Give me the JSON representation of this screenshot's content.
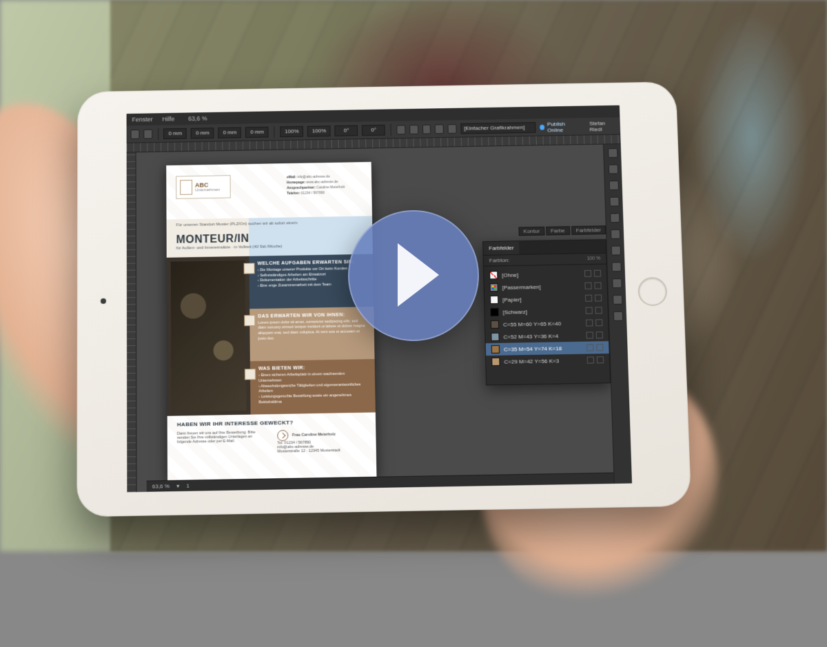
{
  "menu": {
    "items": [
      "Fenster",
      "Hilfe"
    ],
    "zoom": "63,6 %"
  },
  "control_bar": {
    "fields": [
      "0 mm",
      "0 mm",
      "0 mm",
      "0 mm",
      "100%",
      "100%",
      "0°",
      "0°"
    ],
    "publish": "Publish Online",
    "user": "Stefan Riedl"
  },
  "page": {
    "logo": {
      "name": "ABC",
      "sub": "Unternehmen"
    },
    "meta": [
      {
        "label": "eMail:",
        "value": "info@abc-adresse.de"
      },
      {
        "label": "Homepage:",
        "value": "www.abc-adresse.de"
      },
      {
        "label": "Ansprechpartner:",
        "value": "Caroline Meierholz"
      },
      {
        "label": "Telefon:",
        "value": "01234 / 567890"
      }
    ],
    "lead": "Für unseren Standort Muster (PLZ/Ort) suchen wir ab sofort eine/n",
    "title": "MONTEUR/IN",
    "subtitle": "für Außen- und Inneneinsätze · in Vollzeit (40 Std./Woche)",
    "blocks": {
      "a": {
        "heading": "WELCHE AUFGABEN ERWARTEN SIE:",
        "items": [
          "Die Montage unserer Produkte vor Ort beim Kunden",
          "Selbstständiges Arbeiten am Einsatzort",
          "Dokumentation der Arbeitsschritte",
          "Eine enge Zusammenarbeit mit dem Team"
        ]
      },
      "b": {
        "heading": "DAS ERWARTEN WIR VON IHNEN:",
        "text": "Lorem ipsum dolor sit amet, consetetur sadipscing elitr, sed diam nonumy eirmod tempor invidunt ut labore et dolore magna aliquyam erat, sed diam voluptua. At vero eos et accusam et justo duo."
      },
      "c": {
        "heading": "WAS BIETEN WIR:",
        "items": [
          "Einen sicheren Arbeitsplatz in einem wachsenden Unternehmen",
          "Abwechslungsreiche Tätigkeiten und eigenverantwortliches Arbeiten",
          "Leistungsgerechte Bezahlung sowie ein angenehmes Betriebsklima"
        ]
      }
    },
    "footer": {
      "heading": "HABEN WIR IHR INTERESSE GEWECKT?",
      "left": "Dann freuen wir uns auf Ihre Bewerbung. Bitte senden Sie Ihre vollständigen Unterlagen an folgende Adresse oder per E-Mail.",
      "contact_name": "Frau Caroline Meierholz",
      "contact_lines": [
        "Tel. 01234 / 567890",
        "info@abc-adresse.de",
        "Musterstraße 12 · 12345 Musterstadt"
      ]
    }
  },
  "panel": {
    "head_pills": [
      "Kontur",
      "Farbe",
      "Farbfelder"
    ],
    "tabs": [
      "Farbfelder"
    ],
    "sub": "Farbton:",
    "sub_value": "100   %",
    "rows": [
      {
        "cls": "none",
        "label": "[Ohne]"
      },
      {
        "cls": "reg",
        "label": "[Passermarken]"
      },
      {
        "cls": "paper",
        "label": "[Papier]"
      },
      {
        "cls": "black",
        "label": "[Schwarz]"
      },
      {
        "cls": "",
        "label": "C=55 M=60 Y=65 K=40",
        "hex": "#5c5144"
      },
      {
        "cls": "",
        "label": "C=52 M=43 Y=36 K=4",
        "hex": "#8094a2"
      },
      {
        "cls": "",
        "label": "C=35 M=54 Y=74 K=18",
        "hex": "#9c7445",
        "sel": true
      },
      {
        "cls": "",
        "label": "C=29 M=42 Y=56 K=3",
        "hex": "#bb996f"
      }
    ]
  },
  "status": {
    "zoom": "63,6 %",
    "page": "1"
  }
}
